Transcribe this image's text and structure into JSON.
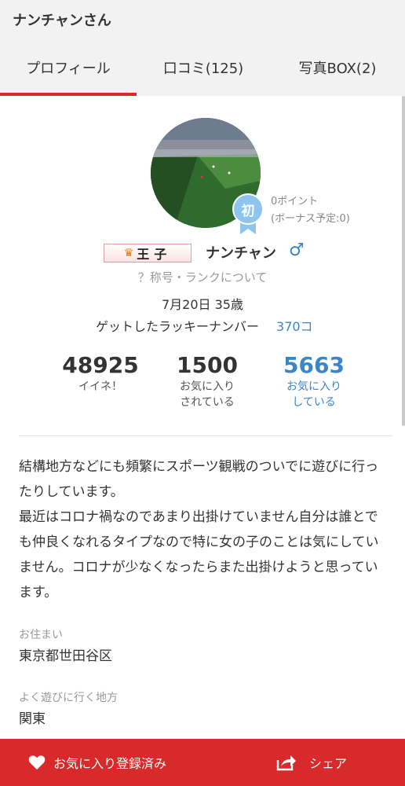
{
  "header": {
    "title": "ナンチャンさん"
  },
  "tabs": [
    {
      "label": "プロフィール"
    },
    {
      "label": "口コミ(125)"
    },
    {
      "label": "写真BOX(2)"
    }
  ],
  "profile": {
    "badge_label": "初",
    "points": "0ポイント",
    "bonus": "(ボーナス予定:0)",
    "title_plate": "王子",
    "username": "ナンチャン",
    "gender_symbol": "♂",
    "rank_link": "？称号・ランクについて",
    "birthday": "7月20日 35歳",
    "lucky_label": "ゲットしたラッキーナンバー",
    "lucky_value": "370コ"
  },
  "stats": [
    {
      "value": "48925",
      "label1": "イイネ！",
      "label2": ""
    },
    {
      "value": "1500",
      "label1": "お気に入り",
      "label2": "されている"
    },
    {
      "value": "5663",
      "label1": "お気に入り",
      "label2": "している"
    }
  ],
  "bio": [
    "結構地方などにも頻繁にスポーツ観戦のついでに遊びに行ったりしています。",
    "最近はコロナ禍なのであまり出掛けていません自分は誰とでも仲良くなれるタイプなので特に女の子のことは気にしていません。コロナが少なくなったらまた出掛けようと思っています。"
  ],
  "residence": {
    "label": "お住まい",
    "value": "東京都世田谷区"
  },
  "frequent": {
    "label": "よく遊びに行く地方",
    "value": "関東"
  },
  "bottom": {
    "favorite": "お気に入り登録済み",
    "share": "シェア"
  },
  "colors": {
    "accent": "#d82a2a",
    "link": "#3a86c8",
    "badge": "#8ec5ee"
  }
}
